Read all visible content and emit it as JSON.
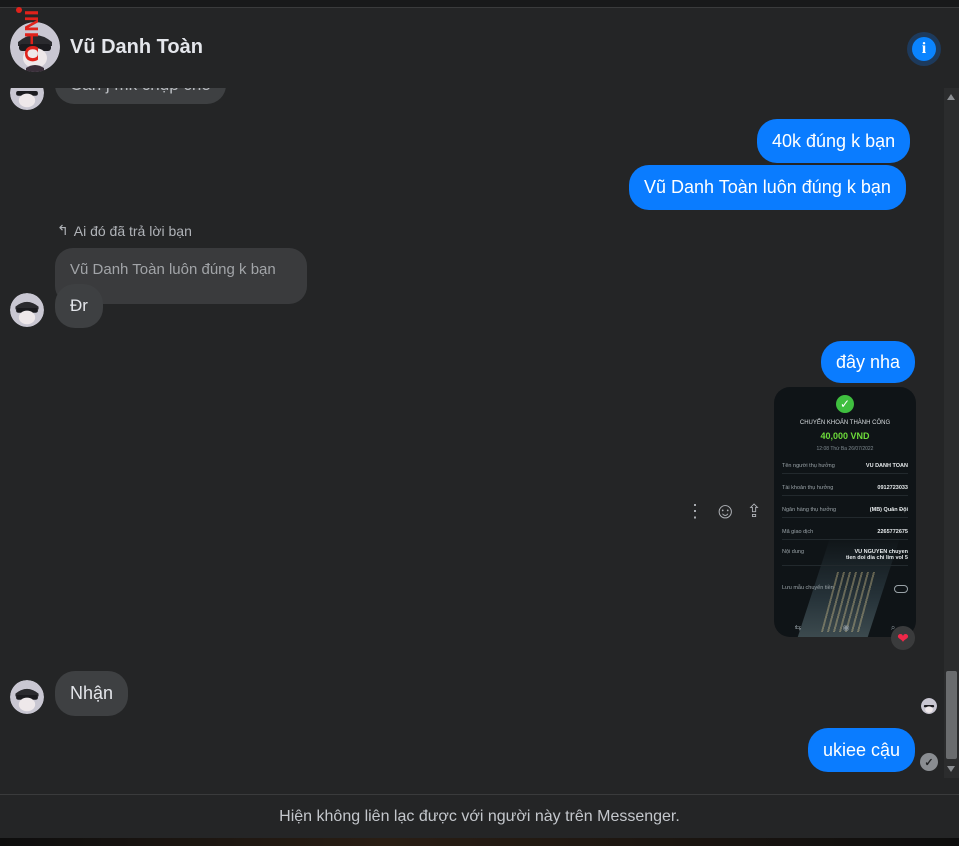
{
  "contact": {
    "name": "Vũ Danh Toàn",
    "info_glyph": "i",
    "brand_overlay": "INFO",
    "avatar_icon": "masked-avatar-icon"
  },
  "messages": {
    "cut_off": "Cần j mk chụp cho",
    "out_1": "40k đúng k bạn",
    "out_2": "Vũ Danh Toàn luôn đúng k bạn",
    "reply_hint": "Ai đó đã trả lời bạn",
    "quoted": "Vũ Danh Toàn luôn đúng k bạn",
    "in_reply": "Đr",
    "out_3": "đây nha",
    "in_2": "Nhận",
    "out_4": "ukiee cậu"
  },
  "receipt": {
    "check_glyph": "✓",
    "title": "CHUYỂN KHOẢN THÀNH CÔNG",
    "amount": "40,000 VND",
    "time": "12:08 Thứ Ba 26/07/2022",
    "rows": [
      {
        "label": "Tên người thụ hưởng",
        "value": "VU DANH TOAN"
      },
      {
        "label": "Tài khoản thụ hưởng",
        "value": "0912723033"
      },
      {
        "label": "Ngân hàng thụ hưởng",
        "value": "(MB) Quân Đội"
      },
      {
        "label": "Mã giao dịch",
        "value": "2265772675"
      },
      {
        "label": "Nội dung",
        "value": "VU NGUYEN chuyen tien doi dia chi lim vol 5"
      },
      {
        "label": "Lưu mẫu chuyển tiền",
        "value": ""
      }
    ],
    "reaction": "❤"
  },
  "actions": {
    "more": "⋮",
    "react": "☺",
    "share": "⇪"
  },
  "status": {
    "sent_glyph": "✓"
  },
  "footer": {
    "notice": "Hiện không liên lạc được với người này trên Messenger."
  }
}
